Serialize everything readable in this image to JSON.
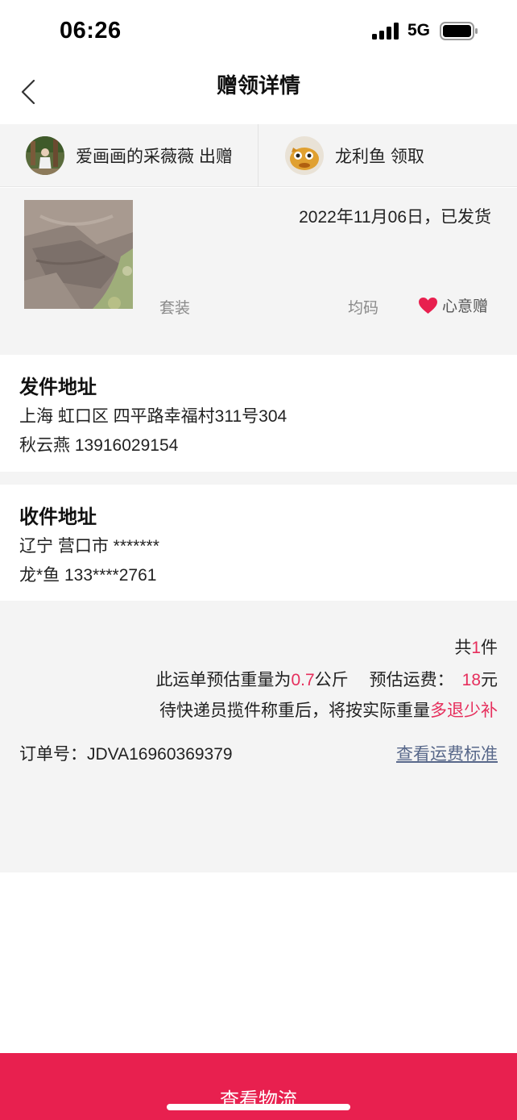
{
  "status_bar": {
    "time": "06:26",
    "network": "5G"
  },
  "nav": {
    "title": "赠领详情"
  },
  "parties": {
    "giver": {
      "name": "爱画画的采薇薇",
      "action": "出赠",
      "display": "爱画画的采薇薇 出赠"
    },
    "receiver": {
      "name": "龙利鱼",
      "action": "领取",
      "display": "龙利鱼 领取"
    }
  },
  "item": {
    "status": "2022年11月06日，已发货",
    "category": "套装",
    "size": "均码",
    "gift_type": "心意赠"
  },
  "sender_address": {
    "title": "发件地址",
    "address": "上海 虹口区 四平路幸福村311号304",
    "contact": "秋云燕 13916029154"
  },
  "receiver_address": {
    "title": "收件地址",
    "address": "辽宁 营口市 *******",
    "contact": "龙*鱼 133****2761"
  },
  "summary": {
    "count_prefix": "共",
    "count": "1",
    "count_suffix": "件",
    "weight_prefix": "此运单预估重量为",
    "weight": "0.7",
    "weight_unit": "公斤",
    "fee_prefix": "预估运费：",
    "fee": "18",
    "fee_unit": "元",
    "note_prefix": "待快递员揽件称重后，将按实际重量",
    "note_highlight": "多退少补",
    "order_label": "订单号：",
    "order_number": "JDVA16960369379",
    "fee_standard_link": "查看运费标准"
  },
  "bottom_button": {
    "label": "查看物流"
  },
  "colors": {
    "accent": "#e8204f",
    "highlight": "#e62e5c",
    "link": "#58688a",
    "panel_bg": "#f4f4f4"
  },
  "icons": {
    "back": "chevron-left-icon",
    "signal": "signal-icon",
    "battery": "battery-icon",
    "heart": "heart-icon"
  }
}
